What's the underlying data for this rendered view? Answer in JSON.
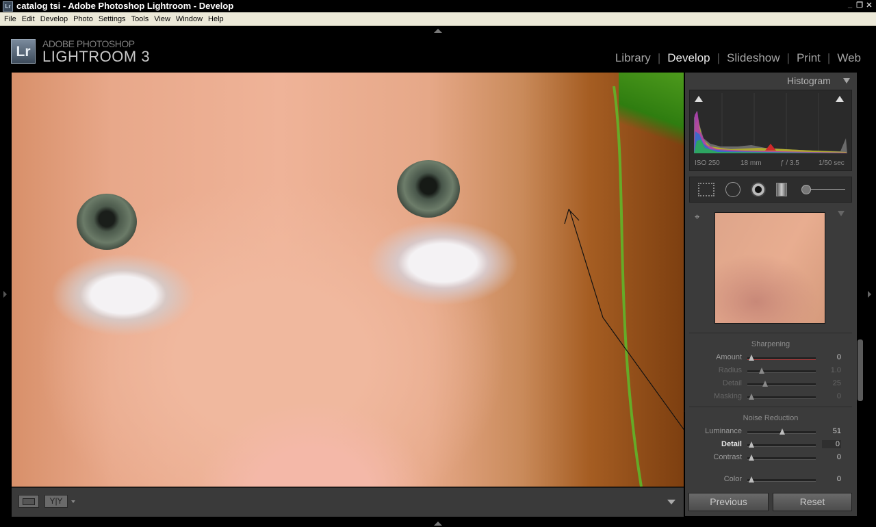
{
  "window": {
    "title": "catalog tsi - Adobe Photoshop Lightroom - Develop",
    "icon_text": "Lr"
  },
  "menu": [
    "File",
    "Edit",
    "Develop",
    "Photo",
    "Settings",
    "Tools",
    "View",
    "Window",
    "Help"
  ],
  "brand": {
    "badge": "Lr",
    "line1": "ADOBE PHOTOSHOP",
    "line2": "LIGHTROOM 3"
  },
  "modules": [
    {
      "label": "Library",
      "active": false
    },
    {
      "label": "Develop",
      "active": true
    },
    {
      "label": "Slideshow",
      "active": false
    },
    {
      "label": "Print",
      "active": false
    },
    {
      "label": "Web",
      "active": false
    }
  ],
  "histogram": {
    "title": "Histogram",
    "iso": "ISO 250",
    "focal": "18 mm",
    "aperture": "ƒ / 3.5",
    "shutter": "1/50 sec"
  },
  "sharpening": {
    "title": "Sharpening",
    "sliders": [
      {
        "label": "Amount",
        "value": "0",
        "pos": 0.0,
        "dim": false,
        "red": true
      },
      {
        "label": "Radius",
        "value": "1.0",
        "pos": 0.17,
        "dim": true
      },
      {
        "label": "Detail",
        "value": "25",
        "pos": 0.22,
        "dim": true
      },
      {
        "label": "Masking",
        "value": "0",
        "pos": 0.0,
        "dim": true
      }
    ]
  },
  "noise_reduction": {
    "title": "Noise Reduction",
    "sliders": [
      {
        "label": "Luminance",
        "value": "51",
        "pos": 0.5,
        "dim": false
      },
      {
        "label": "Detail",
        "value": "0",
        "pos": 0.0,
        "bold": true
      },
      {
        "label": "Contrast",
        "value": "0",
        "pos": 0.0,
        "dim": false
      },
      {
        "label": "Color",
        "value": "0",
        "pos": 0.0,
        "dim": false
      }
    ]
  },
  "buttons": {
    "previous": "Previous",
    "reset": "Reset"
  },
  "colors": {
    "panel_bg": "#3b3b3b",
    "header_bg": "#000000",
    "active_module": "#e8e8e8"
  }
}
